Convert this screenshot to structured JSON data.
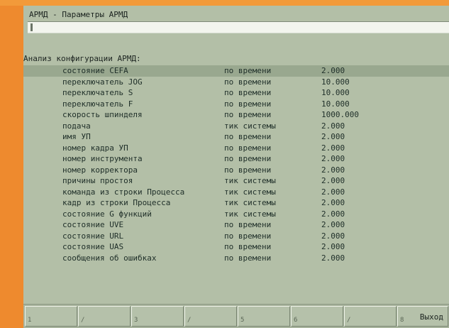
{
  "window": {
    "title": "АРМД - Параметры АРМД",
    "command_input": ""
  },
  "section": {
    "header": "Анализ конфигурации АРМД:"
  },
  "table": {
    "rows": [
      {
        "name": "состояние СЕFA",
        "mode": "по времени",
        "value": "2.000",
        "selected": true
      },
      {
        "name": "переключатель JOG",
        "mode": "по времени",
        "value": "10.000"
      },
      {
        "name": "переключатель S",
        "mode": "по времени",
        "value": "10.000"
      },
      {
        "name": "переключатель F",
        "mode": "по времени",
        "value": "10.000"
      },
      {
        "name": "скорость шпинделя",
        "mode": "по времени",
        "value": "1000.000"
      },
      {
        "name": "подача",
        "mode": "тик системы",
        "value": "2.000"
      },
      {
        "name": "имя УП",
        "mode": "по времени",
        "value": "2.000"
      },
      {
        "name": "номер кадра УП",
        "mode": "по времени",
        "value": "2.000"
      },
      {
        "name": "номер инструмента",
        "mode": "по времени",
        "value": "2.000"
      },
      {
        "name": "номер корректора",
        "mode": "по времени",
        "value": "2.000"
      },
      {
        "name": "причины простоя",
        "mode": "тик системы",
        "value": "2.000"
      },
      {
        "name": "команда из строки Процесса",
        "mode": "тик системы",
        "value": "2.000"
      },
      {
        "name": "кадр из строки Процесса",
        "mode": "тик системы",
        "value": "2.000"
      },
      {
        "name": "состояние G функций",
        "mode": "тик системы",
        "value": "2.000"
      },
      {
        "name": "состояние UVE",
        "mode": "по времени",
        "value": "2.000"
      },
      {
        "name": "состояние URL",
        "mode": "по времени",
        "value": "2.000"
      },
      {
        "name": "состояние UAS",
        "mode": "по времени",
        "value": "2.000"
      },
      {
        "name": "сообщения об ошибках",
        "mode": "по времени",
        "value": "2.000"
      }
    ]
  },
  "softkeys": [
    {
      "mark": "1",
      "label": ""
    },
    {
      "mark": "/",
      "label": ""
    },
    {
      "mark": "3",
      "label": ""
    },
    {
      "mark": "/",
      "label": ""
    },
    {
      "mark": "5",
      "label": ""
    },
    {
      "mark": "6",
      "label": ""
    },
    {
      "mark": "/",
      "label": ""
    },
    {
      "mark": "8",
      "label": "Выход"
    }
  ],
  "colors": {
    "frame": "#ee8a2e",
    "screen": "#b3bfa7",
    "selection": "#99a88f"
  }
}
